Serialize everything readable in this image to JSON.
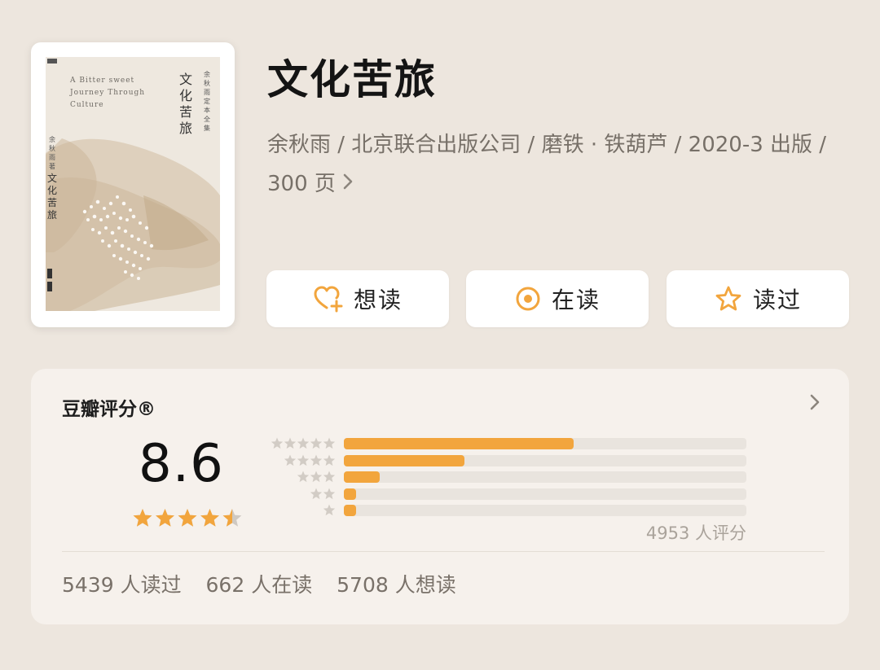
{
  "book": {
    "title": "文化苦旅",
    "meta": "余秋雨 / 北京联合出版公司 / 磨铁 · 铁葫芦 / 2020-3 出版 / 300 页",
    "cover": {
      "english_title": "A Bitter sweet Journey Through Culture",
      "vertical_title": "文化苦旅",
      "series": "余秋雨定本全集",
      "author_line": "余秋雨著",
      "vertical_title_small": "文化苦旅"
    }
  },
  "actions": {
    "want_label": "想读",
    "reading_label": "在读",
    "read_label": "读过"
  },
  "rating": {
    "label": "豆瓣评分®",
    "score": "8.6",
    "stars": 4.5,
    "rating_count_text": "4953 人评分",
    "distribution": [
      {
        "stars": 5,
        "fraction": 0.57
      },
      {
        "stars": 4,
        "fraction": 0.3
      },
      {
        "stars": 3,
        "fraction": 0.09
      },
      {
        "stars": 2,
        "fraction": 0.03
      },
      {
        "stars": 1,
        "fraction": 0.03
      }
    ],
    "read_count": "5439 人读过",
    "reading_count": "662 人在读",
    "want_count": "5708 人想读"
  },
  "colors": {
    "background": "#ede6de",
    "accent": "#f2a53d",
    "card": "#f6f1ec"
  },
  "icons": {
    "want": "heart-plus-icon",
    "reading": "target-circle-icon",
    "read": "star-outline-icon",
    "chevron": "chevron-right-icon"
  }
}
